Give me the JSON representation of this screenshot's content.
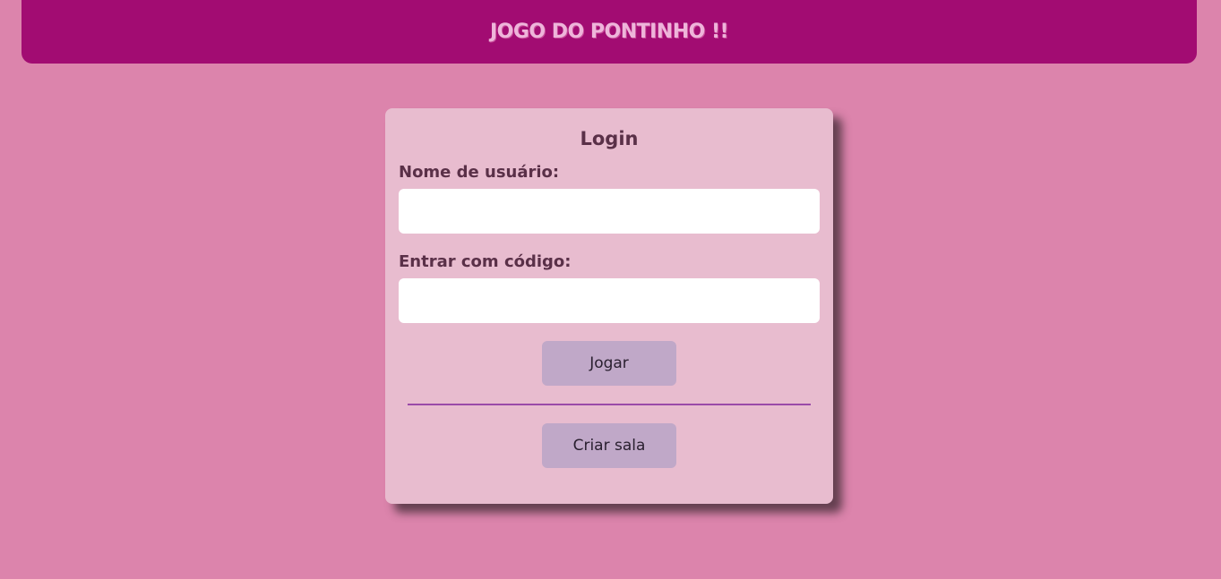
{
  "header": {
    "title": "JOGO DO PONTINHO !!"
  },
  "login": {
    "title": "Login",
    "username_label": "Nome de usuário:",
    "username_value": "",
    "code_label": "Entrar com código:",
    "code_value": "",
    "play_button": "Jogar",
    "create_room_button": "Criar sala"
  },
  "colors": {
    "background": "#dc84ac",
    "header": "#a20c72",
    "header_text": "#eeb5da",
    "card": "#e8bccf",
    "button": "#c0a8c8",
    "divider": "#9a4aa8",
    "label_text": "#5a3048"
  }
}
